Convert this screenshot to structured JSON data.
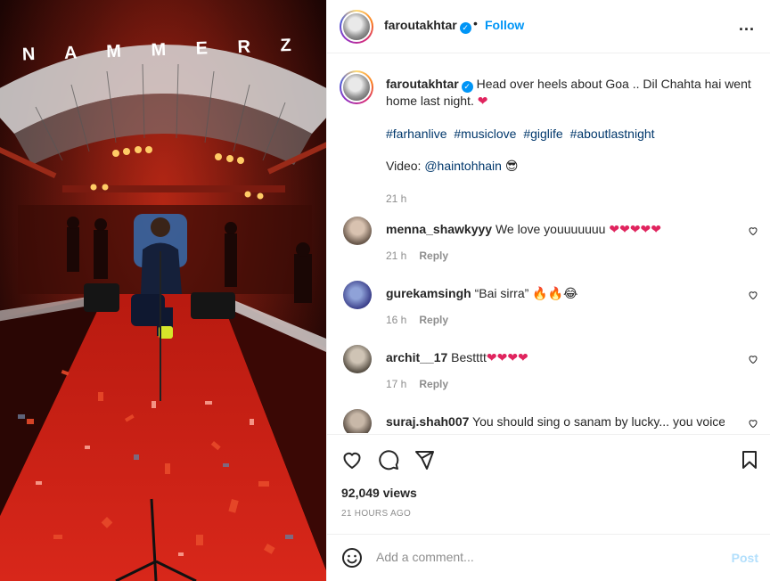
{
  "header": {
    "username": "faroutakhtar",
    "separator": "•",
    "follow_label": "Follow",
    "more_label": "..."
  },
  "caption": {
    "username": "faroutakhtar",
    "text": "Head over heels about Goa .. Dil Chahta hai went home last night.",
    "hashtags": [
      "#farhanlive",
      "#musiclove",
      "#giglife",
      "#aboutlastnight"
    ],
    "video_prefix": "Video:",
    "video_mention": "@haintohhain",
    "time": "21 h"
  },
  "comments": [
    {
      "username": "menna_shawkyyy",
      "text": "We love youuuuuuu",
      "emoji": "❤❤❤❤❤",
      "time": "21 h",
      "reply": "Reply"
    },
    {
      "username": "gurekamsingh",
      "text": "“Bai sirra”",
      "emoji": "🔥🔥😂",
      "time": "16 h",
      "reply": "Reply"
    },
    {
      "username": "archit__17",
      "text": "Bestttt",
      "emoji": "❤❤❤❤",
      "time": "17 h",
      "reply": "Reply"
    },
    {
      "username": "suraj.shah007",
      "text": "You should sing o sanam by lucky... you voice",
      "emoji": "",
      "time": "",
      "reply": ""
    }
  ],
  "media": {
    "sign_text": "N A M M E R Z"
  },
  "stats": {
    "views": "92,049 views",
    "posted_ago": "21 HOURS AGO"
  },
  "comment_box": {
    "placeholder": "Add a comment...",
    "post_label": "Post"
  },
  "colors": {
    "accent": "#0095f6",
    "link": "#00376b",
    "muted": "#8e8e8e",
    "post_disabled": "#b2dffc",
    "heart": "#e0245e"
  }
}
